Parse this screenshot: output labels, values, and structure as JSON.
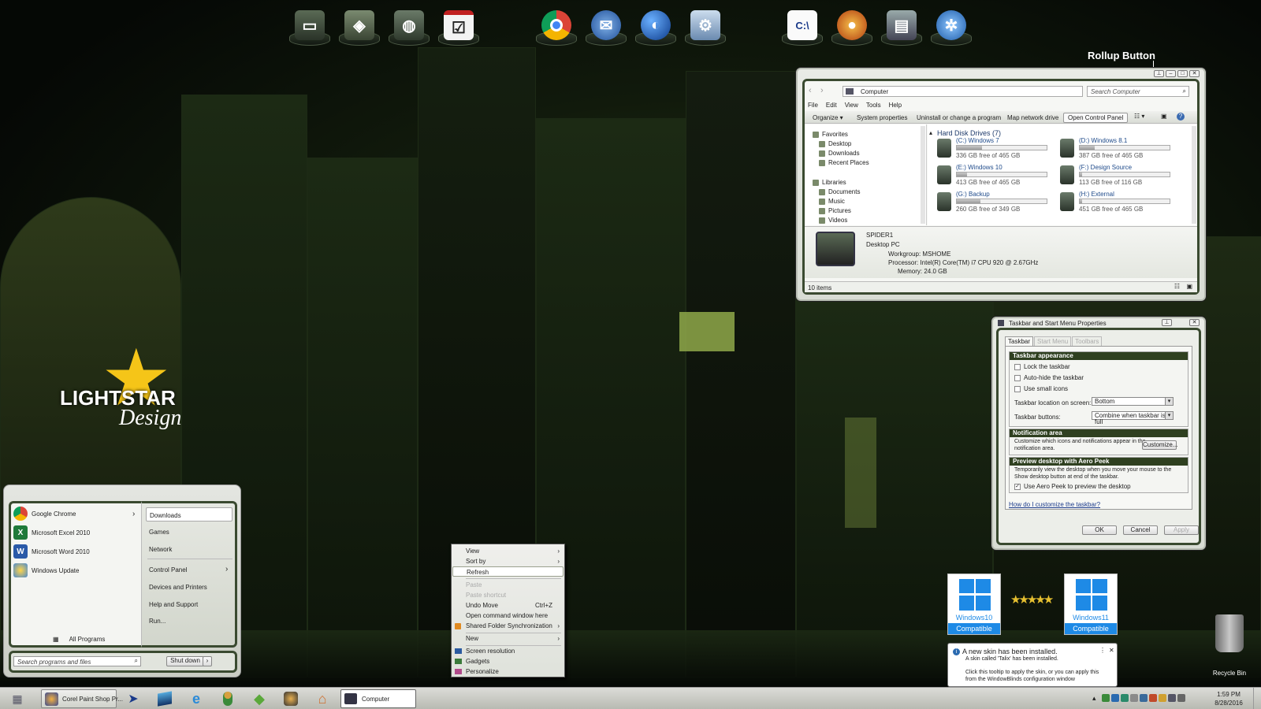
{
  "desktop": {
    "rollup_label": "Rollup Button",
    "recycle_bin": "Recycle Bin",
    "logo_line1": "LIGHTSTAR",
    "logo_line2": "Design",
    "badge_win10": {
      "line1": "Windows10",
      "line2": "Compatible"
    },
    "badge_win11": {
      "line1": "Windows11",
      "line2": "Compatible"
    }
  },
  "dock": {
    "icons": [
      "computer-icon",
      "vault-icon",
      "network-globe-icon",
      "checklist-icon",
      "chrome-icon",
      "thunderbird-icon",
      "google-earth-icon",
      "control-panel-icon",
      "cnet-icon",
      "media-player-icon",
      "server-tower-icon",
      "network-settings-icon"
    ]
  },
  "explorer": {
    "address": "Computer",
    "search_placeholder": "Search Computer",
    "menu": [
      "File",
      "Edit",
      "View",
      "Tools",
      "Help"
    ],
    "toolbar": [
      "Organize ▾",
      "System properties",
      "Uninstall or change a program",
      "Map network drive",
      "Open Control Panel"
    ],
    "nav": {
      "favorites": "Favorites",
      "favorites_items": [
        "Desktop",
        "Downloads",
        "Recent Places"
      ],
      "libraries": "Libraries",
      "libraries_items": [
        "Documents",
        "Music",
        "Pictures",
        "Videos"
      ]
    },
    "section_title": "Hard Disk Drives (7)",
    "drives": [
      {
        "name": "(C:) Windows 7",
        "free": "336 GB free of 465 GB",
        "used_fraction": 0.28
      },
      {
        "name": "(D:) Windows 8.1",
        "free": "387 GB free of 465 GB",
        "used_fraction": 0.17
      },
      {
        "name": "(E:) Windows 10",
        "free": "413 GB free of 465 GB",
        "used_fraction": 0.11
      },
      {
        "name": "(F:) Design Source",
        "free": "113 GB free of 116 GB",
        "used_fraction": 0.03
      },
      {
        "name": "(G:) Backup",
        "free": "260 GB free of 349 GB",
        "used_fraction": 0.26
      },
      {
        "name": "(H:) External",
        "free": "451 GB free of 465 GB",
        "used_fraction": 0.03
      }
    ],
    "details": {
      "name": "SPIDER1",
      "type": "Desktop PC",
      "workgroup": "Workgroup:  MSHOME",
      "processor": "Processor:  Intel(R) Core(TM) i7 CPU       920  @ 2.67GHz",
      "memory": "Memory:  24.0 GB"
    },
    "status": "10 items"
  },
  "taskbar_props": {
    "title": "Taskbar and Start Menu Properties",
    "tabs": [
      "Taskbar",
      "Start Menu",
      "Toolbars"
    ],
    "appearance_header": "Taskbar appearance",
    "lock": "Lock the taskbar",
    "autohide": "Auto-hide the taskbar",
    "small_icons": "Use small icons",
    "location_label": "Taskbar location on screen:",
    "location_value": "Bottom",
    "buttons_label": "Taskbar buttons:",
    "buttons_value": "Combine when taskbar is full",
    "notif_header": "Notification area",
    "notif_text1": "Customize which icons and notifications appear in the",
    "notif_text2": "notification area.",
    "customize": "Customize...",
    "peek_header": "Preview desktop with Aero Peek",
    "peek_text1": "Temporarily view the desktop when you move your mouse to the",
    "peek_text2": "Show desktop button at end of the taskbar.",
    "peek_check": "Use Aero Peek to preview the desktop",
    "help_link": "How do I customize the taskbar?",
    "ok": "OK",
    "cancel": "Cancel",
    "apply": "Apply"
  },
  "context_menu": {
    "items": [
      {
        "label": "View",
        "arrow": "›"
      },
      {
        "label": "Sort by",
        "arrow": "›"
      },
      {
        "label": "Refresh"
      },
      {
        "label": "Paste"
      },
      {
        "label": "Paste shortcut"
      },
      {
        "label": "Undo Move",
        "shortcut": "Ctrl+Z"
      },
      {
        "label": "Open command window here"
      },
      {
        "label": "Shared Folder Synchronization",
        "arrow": "›"
      },
      {
        "label": "New",
        "arrow": "›"
      },
      {
        "label": "Screen resolution"
      },
      {
        "label": "Gadgets"
      },
      {
        "label": "Personalize"
      }
    ]
  },
  "start_menu": {
    "pinned": [
      {
        "label": "Google Chrome",
        "arrow": "›"
      },
      {
        "label": "Microsoft Excel 2010"
      },
      {
        "label": "Microsoft Word 2010"
      },
      {
        "label": "Windows Update"
      }
    ],
    "all_programs": "All Programs",
    "right": [
      "Downloads",
      "Games",
      "Network",
      "Control Panel",
      "Devices and Printers",
      "Help and Support",
      "Run..."
    ],
    "control_panel_arrow": "›",
    "search_placeholder": "Search programs and files",
    "shutdown": "Shut down",
    "shutdown_arrow": "›"
  },
  "notification": {
    "title": "A new skin has been installed.",
    "line1": "A skin called 'Talix' has been installed.",
    "line2": "Click this tooltip to apply the skin, or you can apply this",
    "line3": "from the WindowBlinds configuration window",
    "menu_glyph": "⋮",
    "close_glyph": "✕"
  },
  "taskbar": {
    "paintshop": "Corel Paint Shop Pr...",
    "computer": "Computer",
    "time": "1:59 PM",
    "date": "8/28/2016"
  }
}
